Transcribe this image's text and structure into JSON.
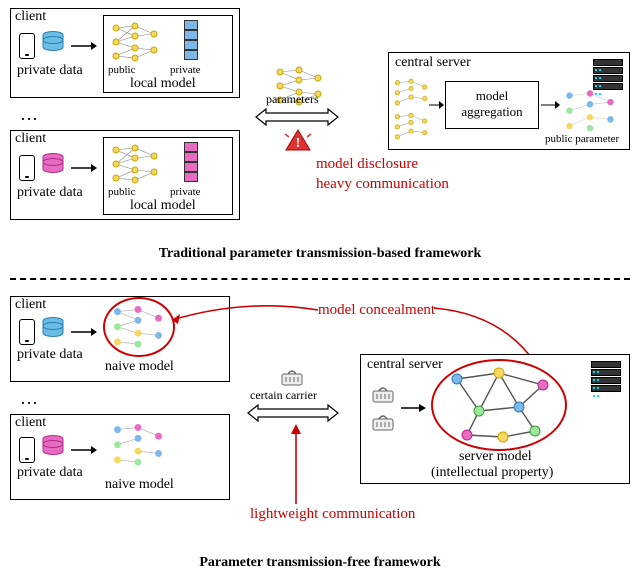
{
  "top": {
    "caption": "Traditional parameter transmission-based framework",
    "client_label": "client",
    "private_data": "private data",
    "local_model": "local model",
    "public": "public",
    "private": "private",
    "ellipsis": "…",
    "parameters": "parameters",
    "problem1": "model disclosure",
    "problem2": "heavy communication",
    "server_label": "central server",
    "aggregation": "model\naggregation",
    "public_param": "public parameter"
  },
  "bottom": {
    "caption": "Parameter transmission-free framework",
    "client_label": "client",
    "private_data": "private data",
    "naive_model": "naive model",
    "ellipsis": "…",
    "carrier": "certain carrier",
    "benefit1": "model concealment",
    "benefit2": "lightweight communication",
    "server_label": "central server",
    "server_model": "server model",
    "ip": "(intellectual property)"
  }
}
